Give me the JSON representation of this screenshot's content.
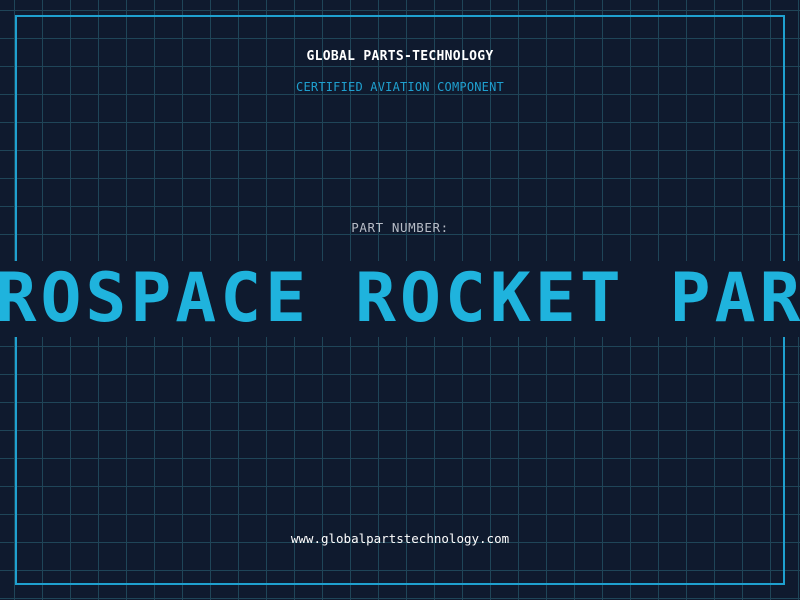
{
  "header": {
    "company": "GLOBAL PARTS-TECHNOLOGY",
    "certification": "CERTIFIED AVIATION COMPONENT"
  },
  "part": {
    "label": "PART NUMBER:",
    "value": "AEROSPACE ROCKET PARTS"
  },
  "footer": {
    "url": "www.globalpartstechnology.com"
  },
  "colors": {
    "background": "#0f1a2e",
    "grid": "#1f4558",
    "accent": "#1fa0cf",
    "text": "#ffffff"
  }
}
